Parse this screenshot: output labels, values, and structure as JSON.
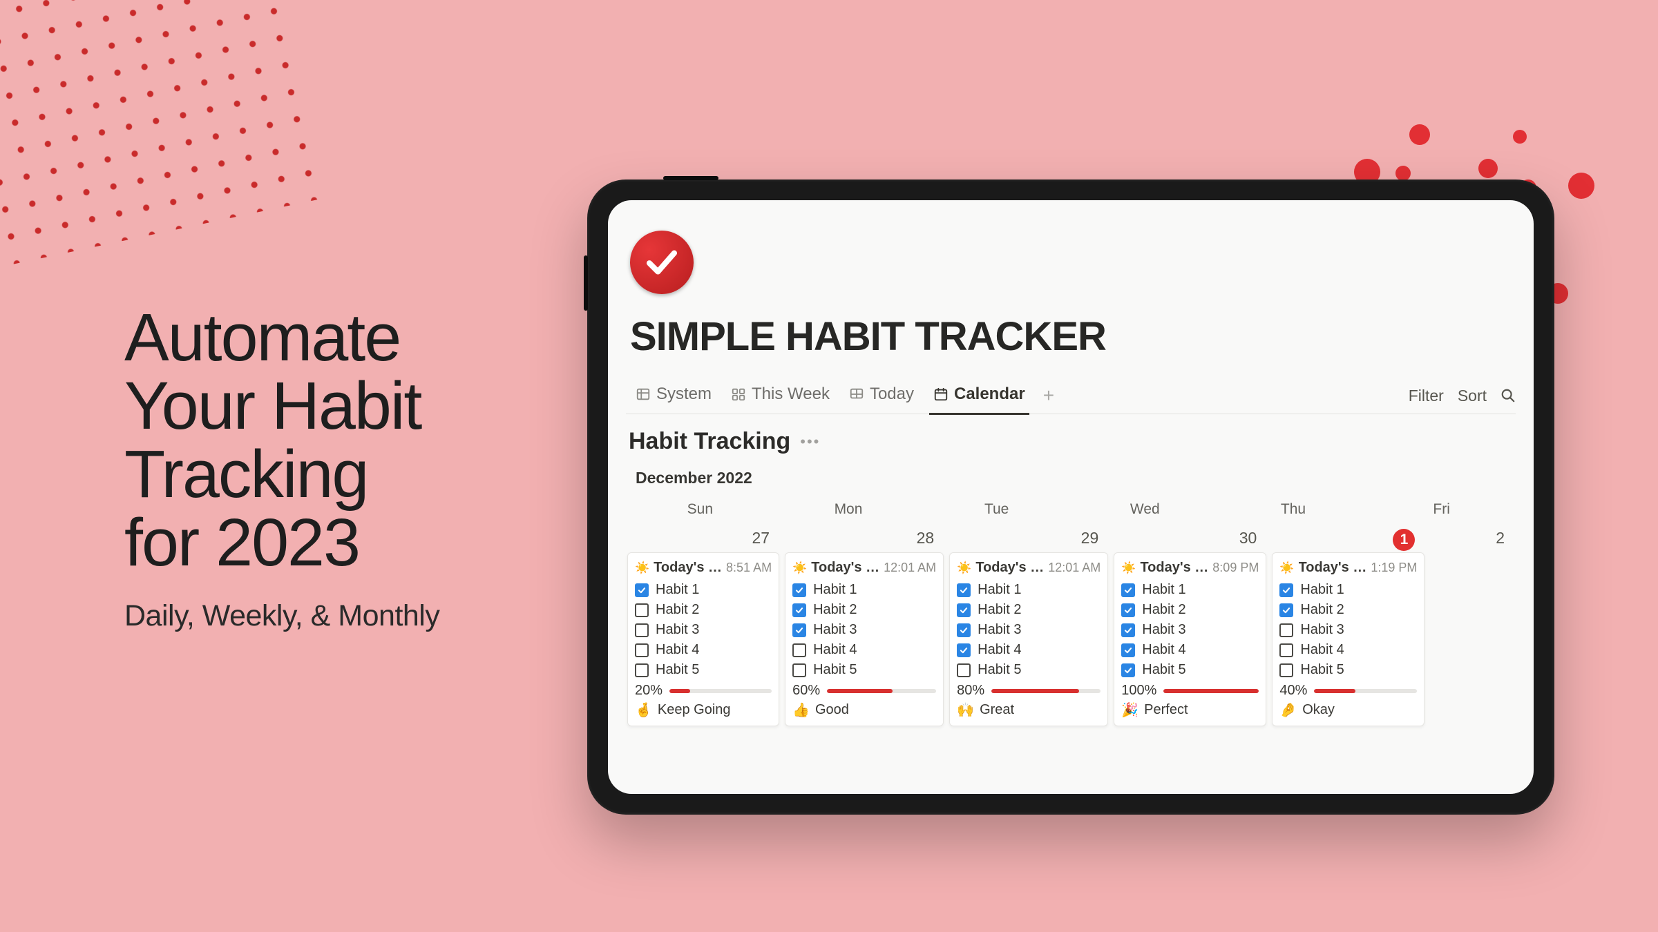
{
  "hero": {
    "title_lines": [
      "Automate",
      "Your Habit",
      "Tracking",
      "for 2023"
    ],
    "subtitle": "Daily, Weekly, & Monthly"
  },
  "app": {
    "title": "SIMPLE HABIT TRACKER",
    "tabs": [
      {
        "id": "system",
        "label": "System",
        "icon": "table",
        "active": false
      },
      {
        "id": "this-week",
        "label": "This Week",
        "icon": "board",
        "active": false
      },
      {
        "id": "today",
        "label": "Today",
        "icon": "gallery",
        "active": false
      },
      {
        "id": "calendar",
        "label": "Calendar",
        "icon": "calendar",
        "active": true
      }
    ],
    "actions": {
      "filter": "Filter",
      "sort": "Sort"
    },
    "db_title": "Habit Tracking",
    "month": "December 2022",
    "weekdays": [
      "Sun",
      "Mon",
      "Tue",
      "Wed",
      "Thu",
      "Fri"
    ],
    "today_date": "1",
    "days": [
      {
        "date": "27",
        "today": false,
        "card": {
          "title": "Today's …",
          "time": "8:51 AM",
          "habits": [
            {
              "label": "Habit 1",
              "done": true
            },
            {
              "label": "Habit 2",
              "done": false
            },
            {
              "label": "Habit 3",
              "done": false
            },
            {
              "label": "Habit 4",
              "done": false
            },
            {
              "label": "Habit 5",
              "done": false
            }
          ],
          "progress": 20,
          "pct_label": "20%",
          "status_emoji": "🤞",
          "status": "Keep Going"
        }
      },
      {
        "date": "28",
        "today": false,
        "card": {
          "title": "Today's …",
          "time": "12:01 AM",
          "habits": [
            {
              "label": "Habit 1",
              "done": true
            },
            {
              "label": "Habit 2",
              "done": true
            },
            {
              "label": "Habit 3",
              "done": true
            },
            {
              "label": "Habit 4",
              "done": false
            },
            {
              "label": "Habit 5",
              "done": false
            }
          ],
          "progress": 60,
          "pct_label": "60%",
          "status_emoji": "👍",
          "status": "Good"
        }
      },
      {
        "date": "29",
        "today": false,
        "card": {
          "title": "Today's …",
          "time": "12:01 AM",
          "habits": [
            {
              "label": "Habit 1",
              "done": true
            },
            {
              "label": "Habit 2",
              "done": true
            },
            {
              "label": "Habit 3",
              "done": true
            },
            {
              "label": "Habit 4",
              "done": true
            },
            {
              "label": "Habit 5",
              "done": false
            }
          ],
          "progress": 80,
          "pct_label": "80%",
          "status_emoji": "🙌",
          "status": "Great"
        }
      },
      {
        "date": "30",
        "today": false,
        "card": {
          "title": "Today's …",
          "time": "8:09 PM",
          "habits": [
            {
              "label": "Habit 1",
              "done": true
            },
            {
              "label": "Habit 2",
              "done": true
            },
            {
              "label": "Habit 3",
              "done": true
            },
            {
              "label": "Habit 4",
              "done": true
            },
            {
              "label": "Habit 5",
              "done": true
            }
          ],
          "progress": 100,
          "pct_label": "100%",
          "status_emoji": "🎉",
          "status": "Perfect"
        }
      },
      {
        "date": "1",
        "today": true,
        "card": {
          "title": "Today's …",
          "time": "1:19 PM",
          "habits": [
            {
              "label": "Habit 1",
              "done": true
            },
            {
              "label": "Habit 2",
              "done": true
            },
            {
              "label": "Habit 3",
              "done": false
            },
            {
              "label": "Habit 4",
              "done": false
            },
            {
              "label": "Habit 5",
              "done": false
            }
          ],
          "progress": 40,
          "pct_label": "40%",
          "status_emoji": "🤌",
          "status": "Okay"
        }
      },
      {
        "date": "2",
        "today": false,
        "card": null
      }
    ]
  },
  "colors": {
    "background": "#F2B0B1",
    "accent_red": "#E2302F",
    "checkbox_blue": "#2A85E4",
    "progress_red": "#D8302F"
  }
}
